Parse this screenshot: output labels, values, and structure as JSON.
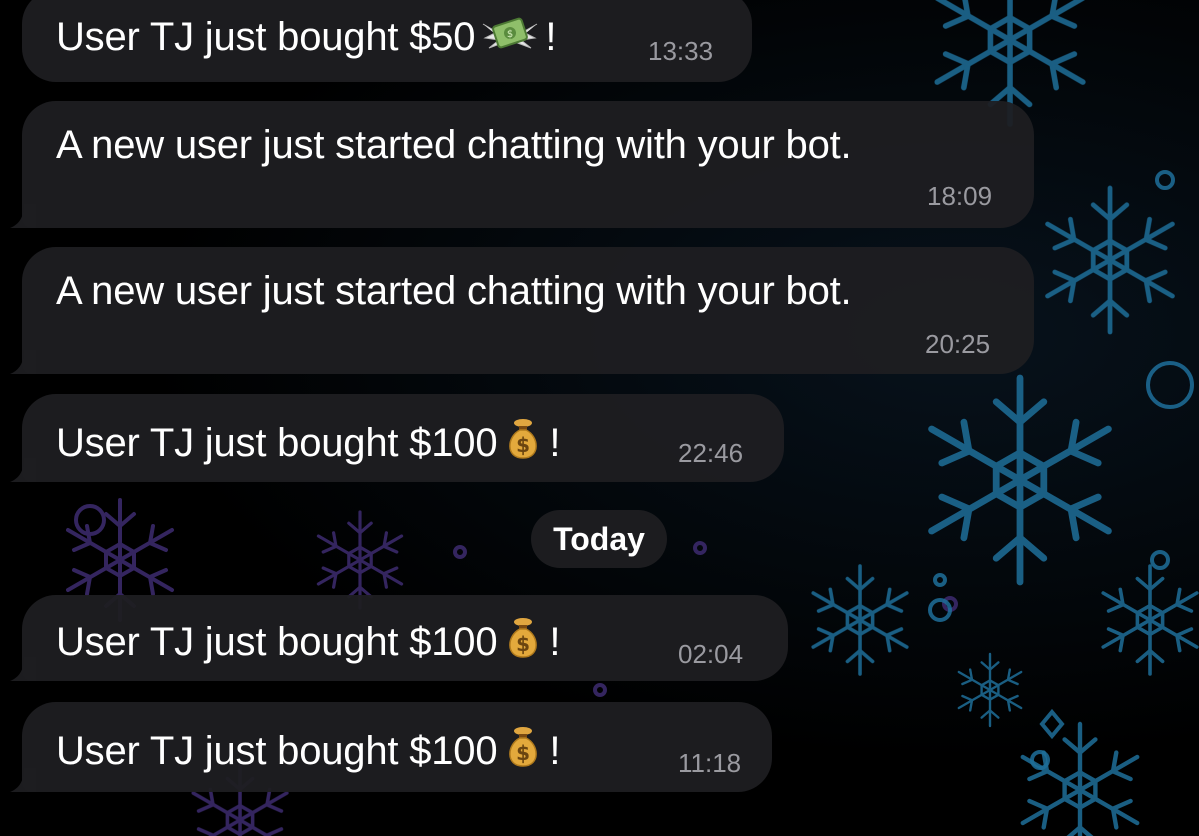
{
  "chat": {
    "messages": [
      {
        "text_before": "User TJ just bought $50",
        "emoji": "money-with-wings-icon",
        "text_after": "!",
        "time": "13:33"
      },
      {
        "text_before": "A new user just started chatting with your bot.",
        "emoji": "",
        "text_after": "",
        "time": "18:09"
      },
      {
        "text_before": "A new user just started chatting with your bot.",
        "emoji": "",
        "text_after": "",
        "time": "20:25"
      },
      {
        "text_before": "User TJ just bought $100",
        "emoji": "money-bag-icon",
        "text_after": "!",
        "time": "22:46"
      },
      {
        "text_before": "User TJ just bought $100",
        "emoji": "money-bag-icon",
        "text_after": "!",
        "time": "02:04"
      },
      {
        "text_before": "User TJ just bought $100",
        "emoji": "money-bag-icon",
        "text_after": "!",
        "time": "11:18"
      }
    ],
    "date_separator": "Today"
  },
  "colors": {
    "bubble": "#1e1e21",
    "time_text": "#9a9aa0",
    "wallpaper_blue": "#1f6f9a",
    "wallpaper_purple": "#3a2a6a"
  }
}
